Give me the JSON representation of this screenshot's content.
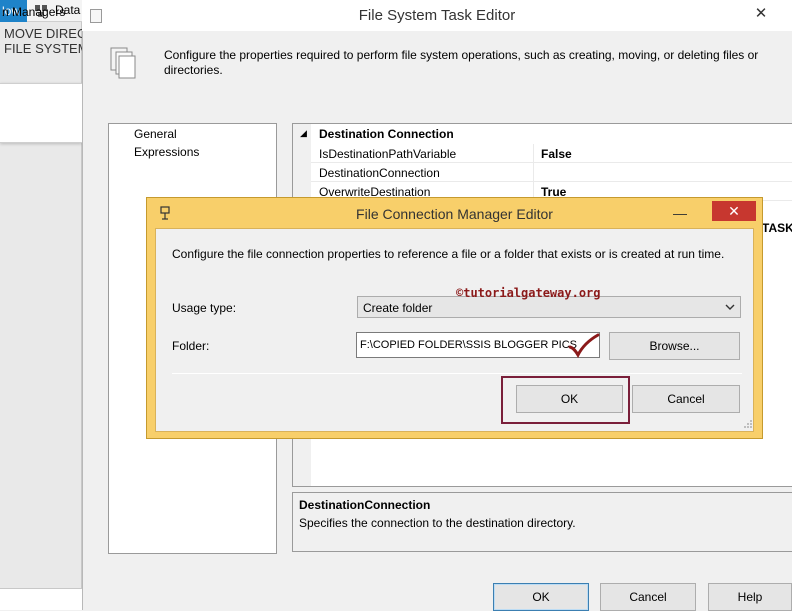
{
  "background": {
    "tabs": [
      {
        "label": "low"
      },
      {
        "label": "Data"
      }
    ],
    "task_name": "MOVE DIREC\nFILE SYSTEM",
    "connection_tab": "n Managers"
  },
  "main_window": {
    "title": "File System Task Editor",
    "close_glyph": "✕",
    "header_text": "Configure the properties required to perform file system operations, such as creating, moving, or deleting files or directories.",
    "nav_items": [
      {
        "label": "General"
      },
      {
        "label": "Expressions"
      }
    ],
    "property_grid": {
      "category": "Destination Connection",
      "collapse_glyph": "◢",
      "rows": [
        {
          "name": "IsDestinationPathVariable",
          "value": "False"
        },
        {
          "name": "DestinationConnection",
          "value": ""
        },
        {
          "name": "OverwriteDestination",
          "value": "True"
        }
      ],
      "hidden_fragment": "TASK"
    },
    "description": {
      "title": "DestinationConnection",
      "text": "Specifies the connection to the destination directory."
    },
    "buttons": {
      "ok": "OK",
      "cancel": "Cancel",
      "help": "Help"
    }
  },
  "dialog": {
    "title": "File Connection Manager Editor",
    "minimize_glyph": "—",
    "close_glyph": "✕",
    "description": "Configure the file connection properties to reference a file or a folder that exists or is created at run time.",
    "usage_type": {
      "label": "Usage type:",
      "value": "Create folder"
    },
    "folder": {
      "label": "Folder:",
      "value": "F:\\COPIED FOLDER\\SSIS BLOGGER PICS"
    },
    "watermark": "©tutorialgateway.org",
    "buttons": {
      "browse": "Browse...",
      "ok": "OK",
      "cancel": "Cancel"
    },
    "colors": {
      "frame": "#f8cf6a",
      "close_button": "#c7372f",
      "highlight_box": "#7a1f3a",
      "checkmark": "#8b1a1a"
    }
  }
}
